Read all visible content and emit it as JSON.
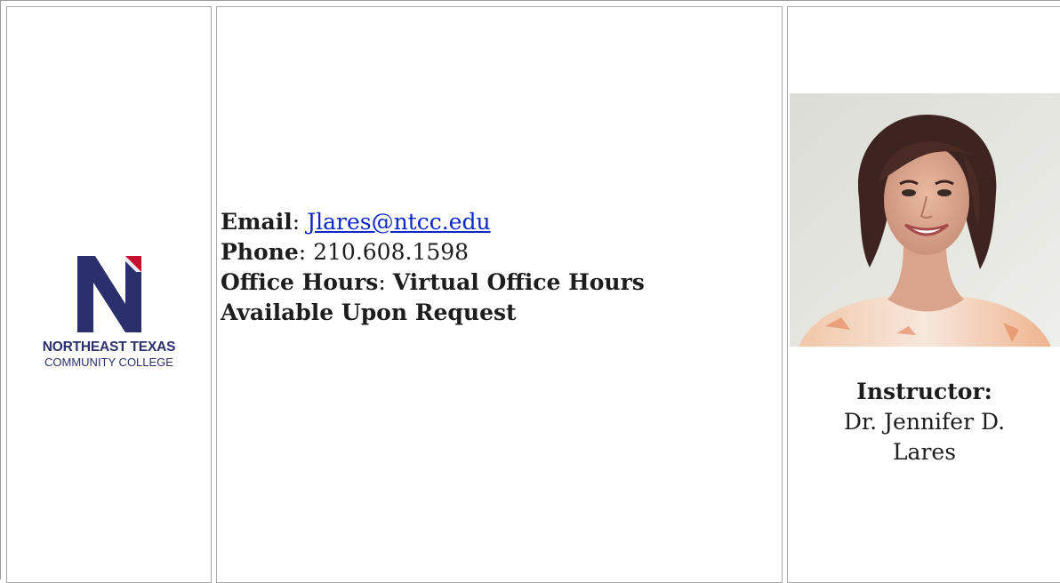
{
  "logo": {
    "line1": "NORTHEAST TEXAS",
    "line2": "COMMUNITY COLLEGE",
    "colors": {
      "navy": "#2b2f6b",
      "red": "#c8102e"
    }
  },
  "contact": {
    "email_label": "Email",
    "email_value": "Jlares@ntcc.edu",
    "phone_label": "Phone",
    "phone_value": "210.608.1598",
    "office_label": "Office Hours",
    "office_value_line1": "Virtual Office Hours",
    "office_value_line2": "Available Upon Request",
    "link_color": "#0b26c9"
  },
  "instructor": {
    "label": "Instructor:",
    "name_line1": "Dr. Jennifer D.",
    "name_line2": "Lares"
  }
}
